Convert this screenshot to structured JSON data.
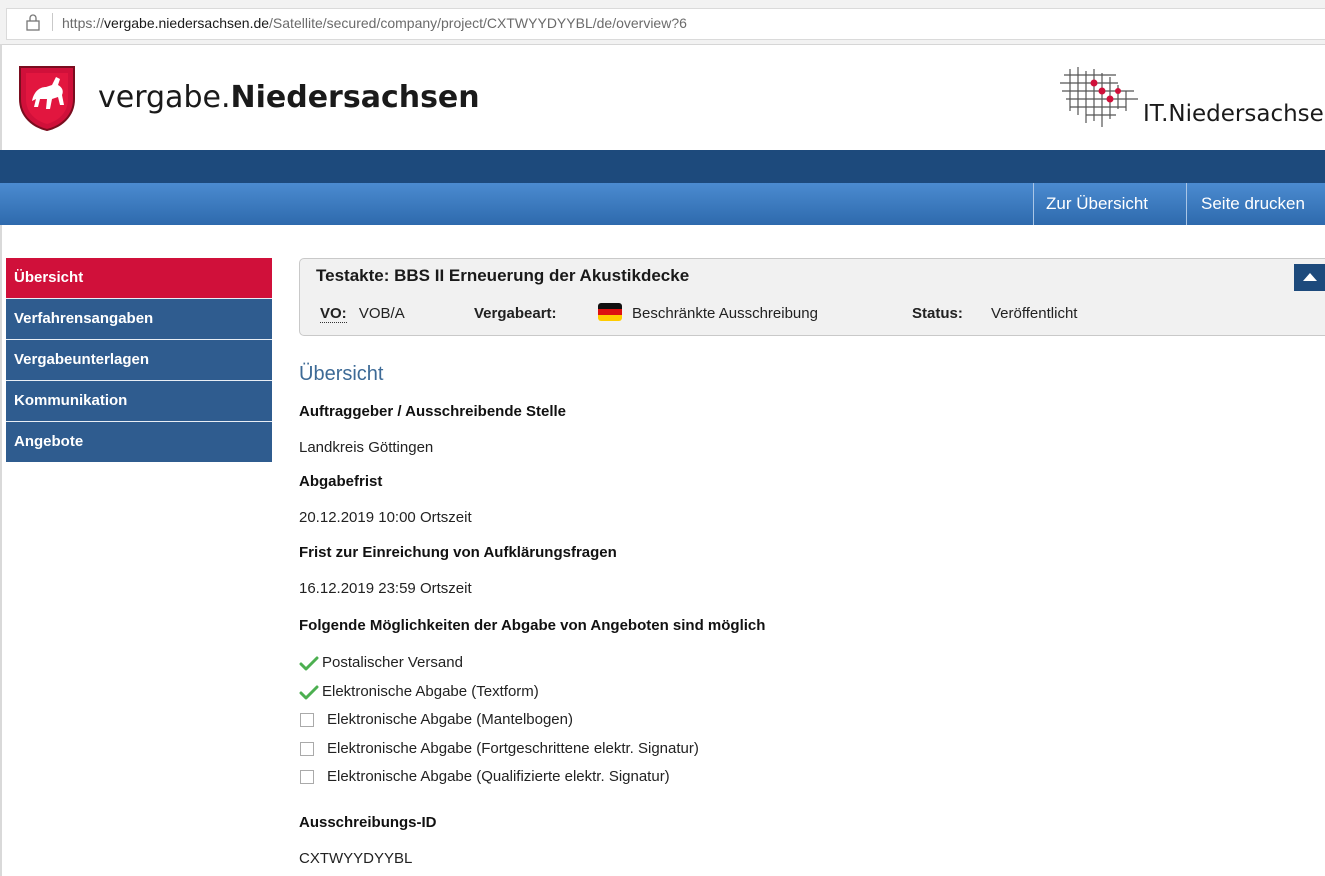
{
  "browser": {
    "url_prefix": "https://",
    "url_host": "vergabe.niedersachsen.de",
    "url_path": "/Satellite/secured/company/project/CXTWYYDYYBL/de/overview?6"
  },
  "header": {
    "brand_light": "vergabe.",
    "brand_bold": "Niedersachsen",
    "partner": "IT.Niedersachsen"
  },
  "topnav": {
    "overview_label": "Zur Übersicht",
    "print_label": "Seite drucken"
  },
  "sidebar": {
    "items": [
      {
        "label": "Übersicht",
        "active": true
      },
      {
        "label": "Verfahrensangaben",
        "active": false
      },
      {
        "label": "Vergabeunterlagen",
        "active": false
      },
      {
        "label": "Kommunikation",
        "active": false
      },
      {
        "label": "Angebote",
        "active": false
      }
    ]
  },
  "project": {
    "title": "Testakte: BBS II Erneuerung der Akustikdecke",
    "vo_label": "VO:",
    "vo_value": "VOB/A",
    "vergabeart_label": "Vergabeart:",
    "vergabeart_value": "Beschränkte Ausschreibung",
    "status_label": "Status:",
    "status_value": "Veröffentlicht"
  },
  "content": {
    "heading": "Übersicht",
    "sections": [
      {
        "label": "Auftraggeber / Ausschreibende Stelle",
        "value": "Landkreis Göttingen"
      },
      {
        "label": "Abgabefrist",
        "value": "20.12.2019 10:00 Ortszeit"
      },
      {
        "label": "Frist zur Einreichung von Aufklärungsfragen",
        "value": "16.12.2019 23:59 Ortszeit"
      }
    ],
    "options_heading": "Folgende Möglichkeiten der Abgabe von Angeboten sind möglich",
    "options": [
      {
        "label": "Postalischer Versand",
        "checked": true
      },
      {
        "label": "Elektronische Abgabe (Textform)",
        "checked": true
      },
      {
        "label": "Elektronische Abgabe (Mantelbogen)",
        "checked": false
      },
      {
        "label": "Elektronische Abgabe (Fortgeschrittene elektr. Signatur)",
        "checked": false
      },
      {
        "label": "Elektronische Abgabe (Qualifizierte elektr. Signatur)",
        "checked": false
      }
    ],
    "id_label": "Ausschreibungs-ID",
    "id_value": "CXTWYYDYYBL"
  },
  "colors": {
    "brand_red": "#d0103a",
    "nav_blue": "#2f5c8f",
    "heading_blue": "#3d6a96",
    "check_green": "#4caf50"
  }
}
